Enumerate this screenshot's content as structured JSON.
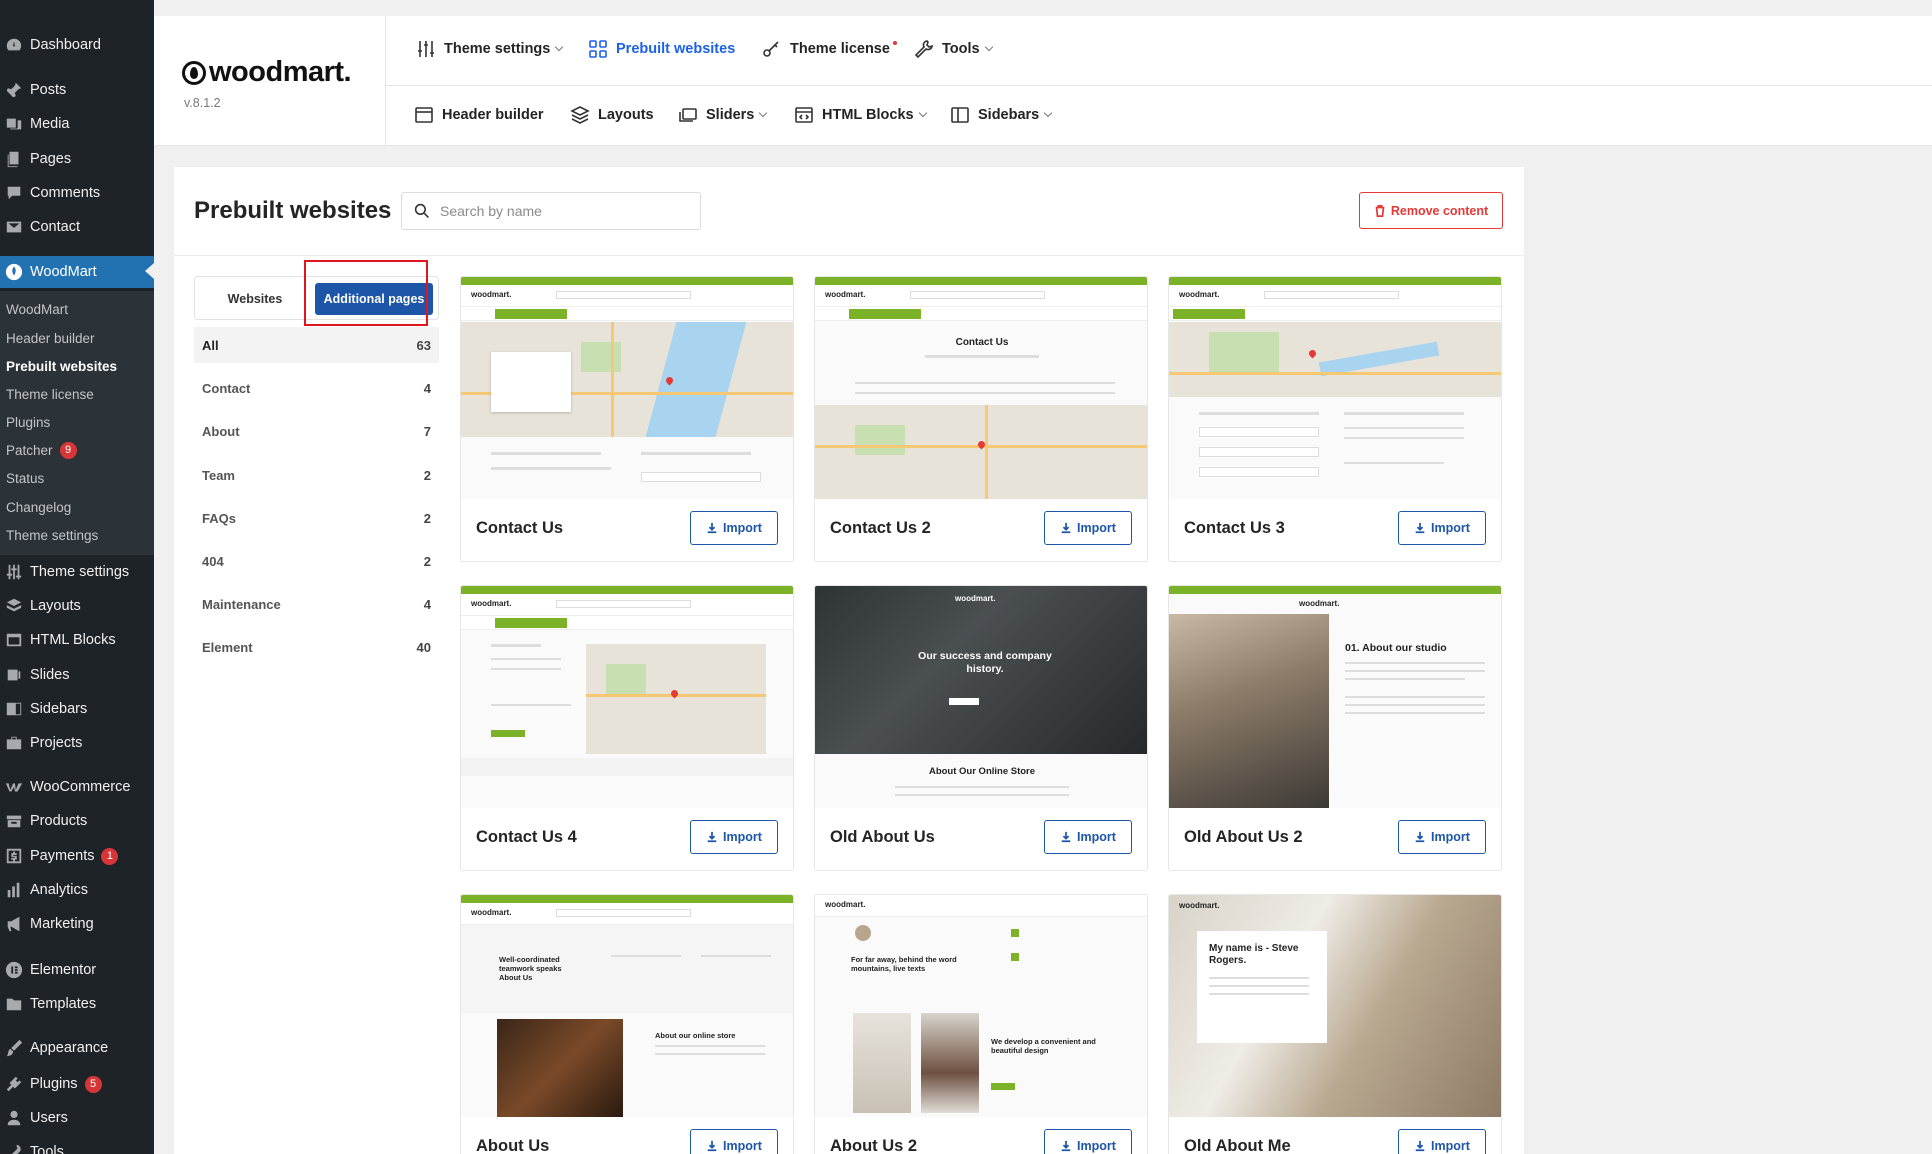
{
  "sidebar": {
    "items": [
      {
        "label": "Dashboard",
        "icon": "dashboard-icon"
      },
      {
        "label": "Posts",
        "icon": "pin-icon"
      },
      {
        "label": "Media",
        "icon": "media-icon"
      },
      {
        "label": "Pages",
        "icon": "pages-icon"
      },
      {
        "label": "Comments",
        "icon": "comments-icon"
      },
      {
        "label": "Contact",
        "icon": "mail-icon"
      },
      {
        "label": "WoodMart",
        "icon": "woodmart-icon"
      }
    ],
    "submenu": [
      "WoodMart",
      "Header builder",
      "Prebuilt websites",
      "Theme license",
      "Plugins",
      "Patcher",
      "Status",
      "Changelog",
      "Theme settings"
    ],
    "patcher_badge": "9",
    "items2": [
      {
        "label": "Theme settings",
        "icon": "sliders-icon"
      },
      {
        "label": "Layouts",
        "icon": "layers-icon"
      },
      {
        "label": "HTML Blocks",
        "icon": "html-icon"
      },
      {
        "label": "Slides",
        "icon": "slides-icon"
      },
      {
        "label": "Sidebars",
        "icon": "sidebar-icon"
      },
      {
        "label": "Projects",
        "icon": "briefcase-icon"
      },
      {
        "label": "WooCommerce",
        "icon": "woo-icon"
      },
      {
        "label": "Products",
        "icon": "box-icon"
      },
      {
        "label": "Payments",
        "icon": "dollar-icon"
      },
      {
        "label": "Analytics",
        "icon": "chart-icon"
      },
      {
        "label": "Marketing",
        "icon": "megaphone-icon"
      },
      {
        "label": "Elementor",
        "icon": "elementor-icon"
      },
      {
        "label": "Templates",
        "icon": "folder-icon"
      },
      {
        "label": "Appearance",
        "icon": "brush-icon"
      },
      {
        "label": "Plugins",
        "icon": "plug-icon"
      },
      {
        "label": "Users",
        "icon": "user-icon"
      },
      {
        "label": "Tools",
        "icon": "wrench-icon"
      }
    ],
    "payments_badge": "1",
    "plugins_badge": "5"
  },
  "header": {
    "logo": "woodmart.",
    "version": "v.8.1.2",
    "row1": [
      "Theme settings",
      "Prebuilt websites",
      "Theme license",
      "Tools"
    ],
    "row2": [
      "Header builder",
      "Layouts",
      "Sliders",
      "HTML Blocks",
      "Sidebars"
    ]
  },
  "panel": {
    "title": "Prebuilt websites",
    "search_placeholder": "Search by name",
    "remove_label": "Remove content",
    "tabs": [
      "Websites",
      "Additional pages"
    ],
    "categories": [
      {
        "name": "All",
        "count": "63"
      },
      {
        "name": "Contact",
        "count": "4"
      },
      {
        "name": "About",
        "count": "7"
      },
      {
        "name": "Team",
        "count": "2"
      },
      {
        "name": "FAQs",
        "count": "2"
      },
      {
        "name": "404",
        "count": "2"
      },
      {
        "name": "Maintenance",
        "count": "4"
      },
      {
        "name": "Element",
        "count": "40"
      }
    ],
    "import_label": "Import",
    "cards": [
      "Contact Us",
      "Contact Us 2",
      "Contact Us 3",
      "Contact Us 4",
      "Old About Us",
      "Old About Us 2",
      "About Us",
      "About Us 2",
      "Old About Me"
    ]
  },
  "thumbs": {
    "wm": "woodmart.",
    "contact_us_heading": "Contact Us",
    "old_about_heading": "Our success and company history.",
    "old_about_caption": "About Our Online Store",
    "about_studio": "01. About our studio",
    "about_us_text": "Well-coordinated teamwork speaks About Us",
    "about_us_store": "About our online store",
    "about2_text": "For far away, behind the word mountains, live texts",
    "about2_develop": "We develop a convenient and beautiful design",
    "about_me": "My name is - Steve Rogers."
  },
  "colors": {
    "accent": "#1d56a8",
    "brand_green": "#7cb228",
    "danger": "#e53935",
    "wp_blue": "#2271b1"
  }
}
